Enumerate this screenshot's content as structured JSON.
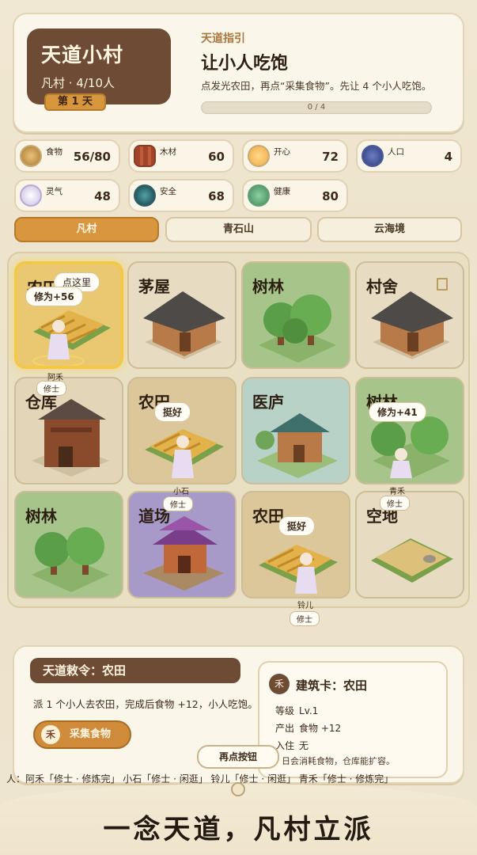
{
  "header": {
    "village_name": "天道小村",
    "village_sub": "凡村 · 4/10人",
    "day": "第 1 天",
    "guide_label": "天道指引",
    "guide_title": "让小人吃饱",
    "guide_desc": "点发光农田，再点“采集食物”。先让 4 个小人吃饱。",
    "progress_text": "0 / 4",
    "progress_fraction": 0
  },
  "resources": [
    {
      "label": "食物",
      "value": "56/80",
      "icon": "wheat-icon"
    },
    {
      "label": "木材",
      "value": "60",
      "icon": "logs-icon"
    },
    {
      "label": "开心",
      "value": "72",
      "icon": "smile-icon"
    },
    {
      "label": "人口",
      "value": "4",
      "icon": "people-icon"
    },
    {
      "label": "灵气",
      "value": "48",
      "icon": "spirit-icon"
    },
    {
      "label": "安全",
      "value": "68",
      "icon": "shield-orb-icon"
    },
    {
      "label": "健康",
      "value": "80",
      "icon": "herb-icon"
    }
  ],
  "tabs": [
    "凡村",
    "青石山",
    "云海境"
  ],
  "tiles": [
    {
      "name": "农田",
      "kind": "farm",
      "highlight": true
    },
    {
      "name": "茅屋",
      "kind": "house"
    },
    {
      "name": "树林",
      "kind": "forest"
    },
    {
      "name": "村舍",
      "kind": "house"
    },
    {
      "name": "仓库",
      "kind": "warehouse"
    },
    {
      "name": "农田",
      "kind": "farm"
    },
    {
      "name": "医庐",
      "kind": "clinic"
    },
    {
      "name": "树林",
      "kind": "forest"
    },
    {
      "name": "树林",
      "kind": "forest"
    },
    {
      "name": "道场",
      "kind": "temple"
    },
    {
      "name": "农田",
      "kind": "farm"
    },
    {
      "name": "空地",
      "kind": "empty"
    }
  ],
  "overlays": {
    "hint_click_here": "点这里",
    "b1_bubble": "修为+56",
    "b1_name": "阿禾",
    "b1_role": "修士",
    "b2_bubble": "挺好",
    "b2_name": "小石",
    "b2_role": "修士",
    "b3_bubble": "修为+41",
    "b3_name": "青禾",
    "b3_role": "修士",
    "b4_bubble": "挺好",
    "b4_name": "铃儿",
    "b4_role": "修士"
  },
  "decree": {
    "title": "天道敕令：农田",
    "desc": "派 1 个小人去农田，完成后食物 +12，小人吃饱。",
    "button": "采集食物",
    "button_seal": "禾"
  },
  "card": {
    "seal": "禾",
    "title": "建筑卡：农田",
    "level_label": "等级",
    "level_value": "Lv.1",
    "output_label": "产出",
    "output_value": "食物 +12",
    "occupant_label": "入住",
    "occupant_value": "无",
    "foot": "日会消耗食物，仓库能扩容。"
  },
  "replay_button": "再点按钮",
  "status_strip": "人：阿禾「修士 · 修炼完」 小石「修士 · 闲逛」 铃儿「修士 · 闲逛」 青禾「修士 · 修炼完」",
  "slogan": "一念天道，凡村立派",
  "colors": {
    "accent": "#d8963f",
    "brown": "#6e4b34",
    "highlight": "#f2c84b"
  }
}
